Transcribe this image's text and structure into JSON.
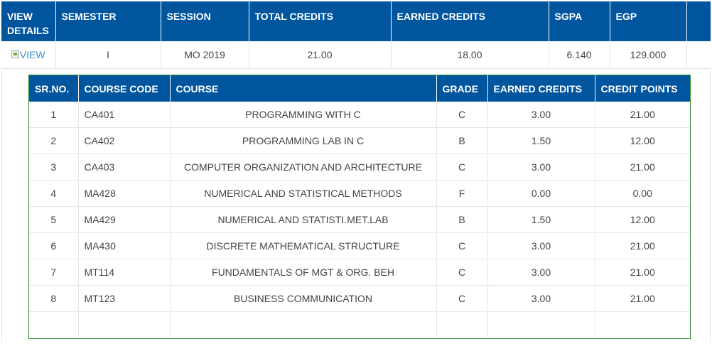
{
  "semester_table": {
    "headers": [
      "VIEW DETAILS",
      "SEMESTER",
      "SESSION",
      "TOTAL CREDITS",
      "EARNED CREDITS",
      "SGPA",
      "EGP",
      ""
    ],
    "row": {
      "view_alt": "VIEW",
      "semester": "I",
      "session": "MO 2019",
      "total_credits": "21.00",
      "earned_credits": "18.00",
      "sgpa": "6.140",
      "egp": "129.000"
    }
  },
  "course_table": {
    "headers": [
      "SR.NO.",
      "COURSE CODE",
      "COURSE",
      "GRADE",
      "EARNED CREDITS",
      "CREDIT POINTS"
    ],
    "rows": [
      [
        "1",
        "CA401",
        "PROGRAMMING WITH C",
        "C",
        "3.00",
        "21.00"
      ],
      [
        "2",
        "CA402",
        "PROGRAMMING LAB IN C",
        "B",
        "1.50",
        "12.00"
      ],
      [
        "3",
        "CA403",
        "COMPUTER ORGANIZATION AND ARCHITECTURE",
        "C",
        "3.00",
        "21.00"
      ],
      [
        "4",
        "MA428",
        "NUMERICAL AND STATISTICAL METHODS",
        "F",
        "0.00",
        "0.00"
      ],
      [
        "5",
        "MA429",
        "NUMERICAL AND STATISTI.MET.LAB",
        "B",
        "1.50",
        "12.00"
      ],
      [
        "6",
        "MA430",
        "DISCRETE MATHEMATICAL STRUCTURE",
        "C",
        "3.00",
        "21.00"
      ],
      [
        "7",
        "MT114",
        "FUNDAMENTALS OF MGT & ORG. BEH",
        "C",
        "3.00",
        "21.00"
      ],
      [
        "8",
        "MT123",
        "BUSINESS COMMUNICATION",
        "C",
        "3.00",
        "21.00"
      ]
    ]
  },
  "colors": {
    "header_bg": "#00559f",
    "inner_border": "#2e8b2e",
    "link": "#3a8fd1"
  },
  "icons": {
    "view": "broken-image-icon"
  }
}
